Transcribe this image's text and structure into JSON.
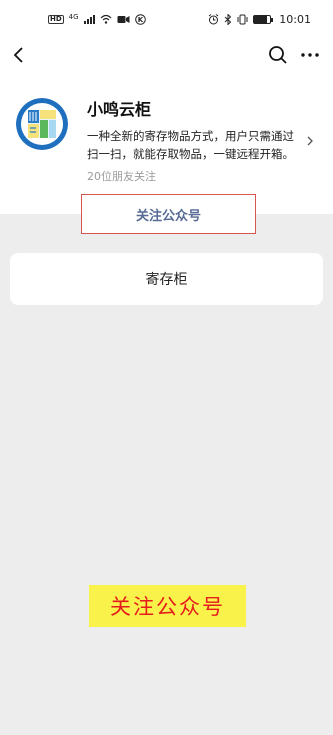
{
  "status_bar": {
    "left_badges": [
      "HD",
      "4G"
    ],
    "time": "10:01",
    "battery_level": 0.8
  },
  "nav": {
    "back_icon": "chevron-left-icon",
    "search_icon": "search-icon",
    "more_icon": "more-horizontal-icon"
  },
  "account": {
    "name": "小鸣云柜",
    "description": "一种全新的寄存物品方式，用户只需通过扫一扫，就能存取物品，一键远程开箱。",
    "followers": "20位朋友关注",
    "follow_button": "关注公众号",
    "avatar_colors": {
      "ring": "#1f6fbf",
      "green": "#5cb85c",
      "yellow": "#f6e27a"
    }
  },
  "menu": {
    "items": [
      {
        "label": "寄存柜"
      }
    ]
  },
  "annotation": {
    "label": "关注公众号",
    "bg": "#f9f24a",
    "color": "#e51c1c"
  }
}
